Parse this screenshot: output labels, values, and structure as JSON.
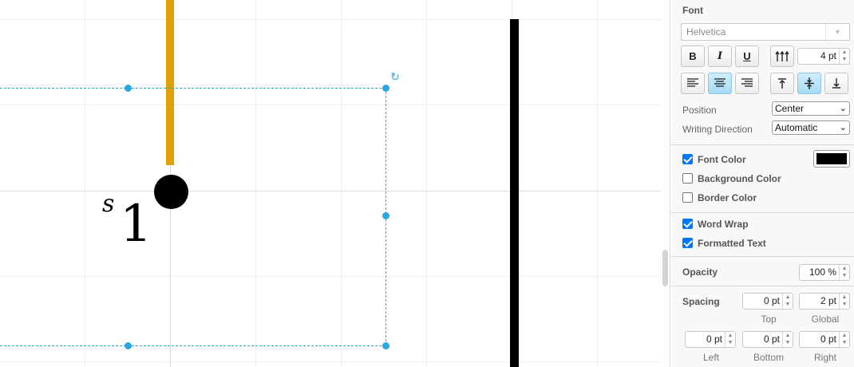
{
  "canvas": {
    "label_var": "s",
    "label_num": "1",
    "colors": {
      "orange_edge": "#e1a100",
      "selection": "#29a8e0",
      "shape": "#000000"
    }
  },
  "panel": {
    "font": {
      "title": "Font",
      "family": "Helvetica",
      "bold_label": "B",
      "italic_label": "I",
      "underline_label": "U",
      "font_size": "4 pt",
      "position_label": "Position",
      "position_value": "Center",
      "direction_label": "Writing Direction",
      "direction_value": "Automatic"
    },
    "colors": {
      "font_color_label": "Font Color",
      "font_color_value": "#000000",
      "background_color_label": "Background Color",
      "border_color_label": "Border Color"
    },
    "text": {
      "word_wrap_label": "Word Wrap",
      "formatted_text_label": "Formatted Text"
    },
    "opacity": {
      "label": "Opacity",
      "value": "100 %"
    },
    "spacing": {
      "label": "Spacing",
      "top_value": "0 pt",
      "top_label": "Top",
      "global_value": "2 pt",
      "global_label": "Global",
      "left_value": "0 pt",
      "left_label": "Left",
      "bottom_value": "0 pt",
      "bottom_label": "Bottom",
      "right_value": "0 pt",
      "right_label": "Right"
    },
    "checks": {
      "font_color": true,
      "background_color": false,
      "border_color": false,
      "word_wrap": true,
      "formatted_text": true
    }
  }
}
